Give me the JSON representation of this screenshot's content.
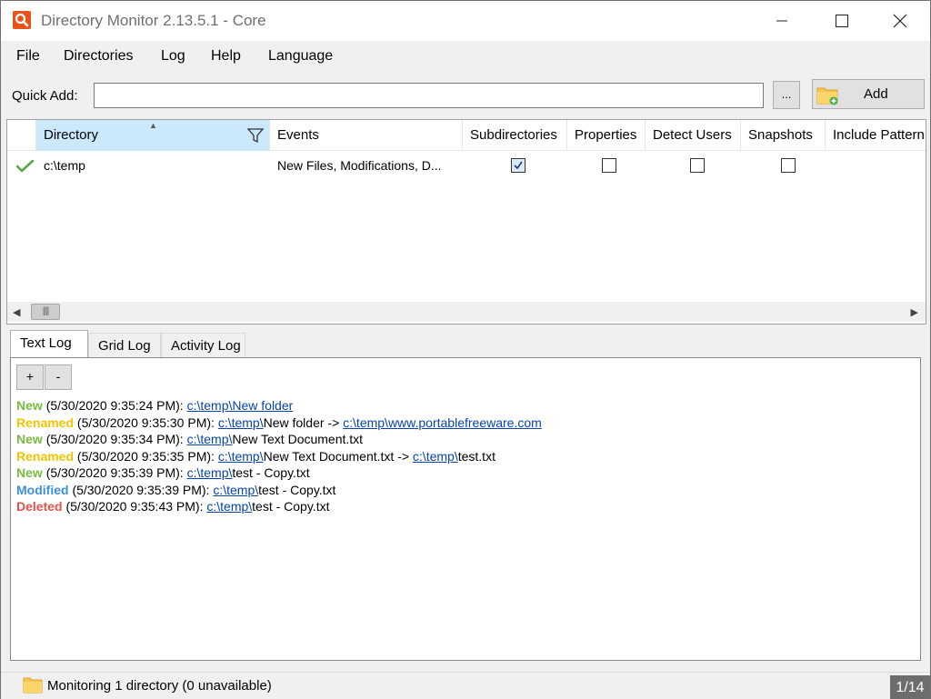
{
  "window": {
    "title": "Directory Monitor 2.13.5.1 - Core"
  },
  "menu": [
    "File",
    "Directories",
    "Log",
    "Help",
    "Language"
  ],
  "quick_add": {
    "label": "Quick Add:",
    "value": "",
    "browse_label": "...",
    "add_label": "Add"
  },
  "grid": {
    "columns": [
      "",
      "Directory",
      "Events",
      "Subdirectories",
      "Properties",
      "Detect Users",
      "Snapshots",
      "Include Pattern"
    ],
    "sorted_column": "Directory",
    "rows": [
      {
        "status": "ok",
        "directory": "c:\\temp",
        "events": "New Files, Modifications, D...",
        "subdirectories": true,
        "properties": false,
        "detect_users": false,
        "snapshots": false
      }
    ]
  },
  "tabs": {
    "items": [
      "Text Log",
      "Grid Log",
      "Activity Log"
    ],
    "active": "Text Log"
  },
  "log": {
    "plus_label": "+",
    "minus_label": "-",
    "entries": [
      {
        "type": "New",
        "kind": "new",
        "time": "(5/30/2020 9:35:24 PM):",
        "link1": "c:\\temp\\New folder",
        "text1": "",
        "arrow": "",
        "link2": "",
        "text2": ""
      },
      {
        "type": "Renamed",
        "kind": "renamed",
        "time": "(5/30/2020 9:35:30 PM):",
        "link1": "c:\\temp\\",
        "text1": "New folder",
        "arrow": " -> ",
        "link2": "c:\\temp\\www.portablefreeware.com",
        "text2": ""
      },
      {
        "type": "New",
        "kind": "new",
        "time": "(5/30/2020 9:35:34 PM):",
        "link1": "c:\\temp\\",
        "text1": "New Text Document.txt",
        "arrow": "",
        "link2": "",
        "text2": ""
      },
      {
        "type": "Renamed",
        "kind": "renamed",
        "time": "(5/30/2020 9:35:35 PM):",
        "link1": "c:\\temp\\",
        "text1": "New Text Document.txt",
        "arrow": " -> ",
        "link2": "c:\\temp\\",
        "text2": "test.txt"
      },
      {
        "type": "New",
        "kind": "new",
        "time": "(5/30/2020 9:35:39 PM):",
        "link1": "c:\\temp\\",
        "text1": "test - Copy.txt",
        "arrow": "",
        "link2": "",
        "text2": ""
      },
      {
        "type": "Modified",
        "kind": "modified",
        "time": "(5/30/2020 9:35:39 PM):",
        "link1": "c:\\temp\\",
        "text1": "test - Copy.txt",
        "arrow": "",
        "link2": "",
        "text2": ""
      },
      {
        "type": "Deleted",
        "kind": "deleted",
        "time": "(5/30/2020 9:35:43 PM):",
        "link1": "c:\\temp\\",
        "text1": "test - Copy.txt",
        "arrow": "",
        "link2": "",
        "text2": ""
      }
    ]
  },
  "status": {
    "text": "Monitoring 1 directory (0 unavailable)",
    "page": "1/14"
  },
  "colors": {
    "new": "#78bb3f",
    "renamed": "#f4c400",
    "modified": "#3f8fe0",
    "deleted": "#e8524a",
    "link": "#0645ad",
    "sorted_header": "#cce8fb",
    "app_icon": "#e8531a"
  },
  "icons": [
    "app-search-icon",
    "minimize-icon",
    "maximize-icon",
    "close-icon",
    "folder-add-icon",
    "sort-asc-icon",
    "filter-icon",
    "checkmark-icon",
    "scroll-left-icon",
    "scroll-right-icon",
    "folder-icon"
  ]
}
